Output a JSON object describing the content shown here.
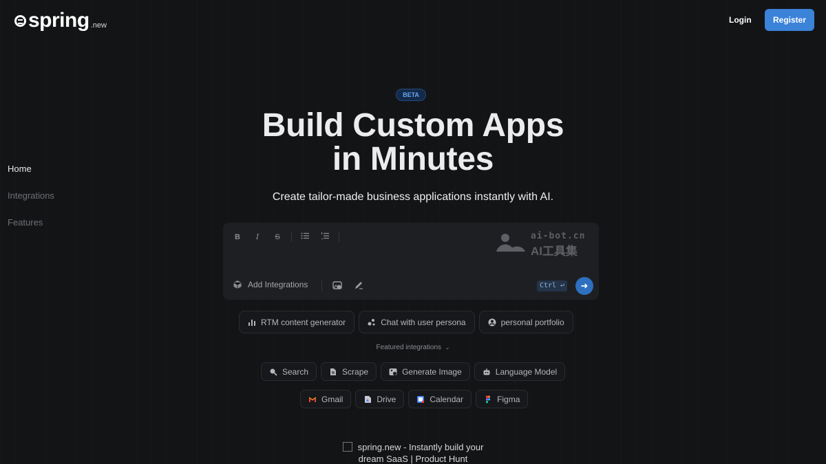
{
  "header": {
    "logo_text": "spring",
    "logo_suffix": ".new",
    "login_label": "Login",
    "register_label": "Register"
  },
  "side_nav": [
    {
      "label": "Home",
      "active": true
    },
    {
      "label": "Integrations",
      "active": false
    },
    {
      "label": "Features",
      "active": false
    }
  ],
  "hero": {
    "badge": "BETA",
    "title_line1": "Build Custom Apps",
    "title_line2": "in Minutes",
    "subtitle": "Create tailor-made business applications instantly with AI."
  },
  "editor": {
    "toolbar": [
      {
        "name": "bold",
        "glyph": "B"
      },
      {
        "name": "italic",
        "glyph": "I"
      },
      {
        "name": "strikethrough",
        "glyph": "S"
      },
      {
        "name": "bullet-list",
        "glyph": "≡"
      },
      {
        "name": "numbered-list",
        "glyph": "≡"
      }
    ],
    "add_integrations_label": "Add Integrations",
    "shortcut_hint": "Ctrl ↩",
    "send_glyph": "➜"
  },
  "watermark": {
    "top": "ai-bot.cn",
    "bottom": "AI工具集"
  },
  "suggestions": [
    {
      "label": "RTM content generator",
      "icon": "bar-chart-icon"
    },
    {
      "label": "Chat with user persona",
      "icon": "persona-icon"
    },
    {
      "label": "personal portfolio",
      "icon": "user-circle-icon"
    }
  ],
  "featured_label": "Featured integrations",
  "integrations_row1": [
    {
      "label": "Search",
      "icon": "search-icon"
    },
    {
      "label": "Scrape",
      "icon": "document-icon"
    },
    {
      "label": "Generate Image",
      "icon": "image-icon"
    },
    {
      "label": "Language Model",
      "icon": "robot-icon"
    }
  ],
  "integrations_row2": [
    {
      "label": "Gmail",
      "icon": "gmail-icon"
    },
    {
      "label": "Drive",
      "icon": "drive-icon"
    },
    {
      "label": "Calendar",
      "icon": "calendar-icon"
    },
    {
      "label": "Figma",
      "icon": "figma-icon"
    }
  ],
  "product_hunt_alt": "spring.new - Instantly build your dream SaaS | Product Hunt",
  "colors": {
    "background": "#131416",
    "accent": "#3b82d9",
    "badge_text": "#6aa6f0"
  }
}
